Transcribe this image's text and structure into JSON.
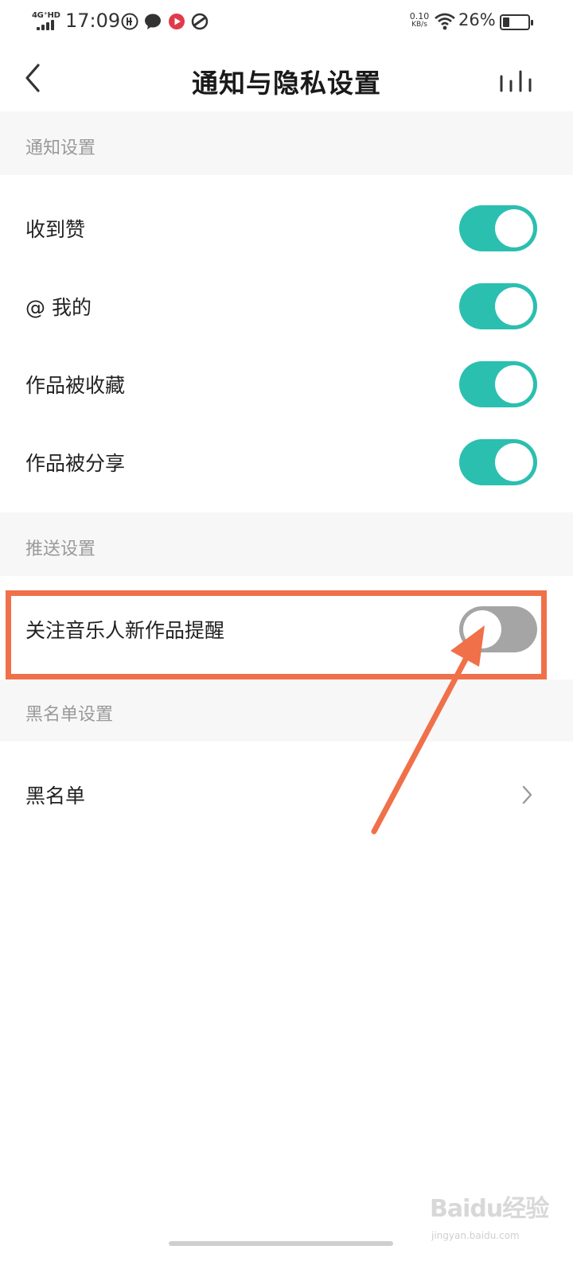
{
  "status_bar": {
    "network": "4G⁺HD",
    "time": "17:09",
    "net_speed_value": "0.10",
    "net_speed_unit": "KB/s",
    "battery_percent": "26%"
  },
  "header": {
    "title": "通知与隐私设置"
  },
  "sections": {
    "notify": {
      "title": "通知设置",
      "items": [
        {
          "label": "收到赞",
          "enabled": true
        },
        {
          "label": "@ 我的",
          "enabled": true
        },
        {
          "label": "作品被收藏",
          "enabled": true
        },
        {
          "label": "作品被分享",
          "enabled": true
        }
      ]
    },
    "push": {
      "title": "推送设置",
      "items": [
        {
          "label": "关注音乐人新作品提醒",
          "enabled": false
        }
      ]
    },
    "blacklist": {
      "title": "黑名单设置",
      "items": [
        {
          "label": "黑名单"
        }
      ]
    }
  },
  "colors": {
    "toggle_on": "#2bbfb0",
    "toggle_off": "#a5a5a5",
    "annotation": "#f0704a"
  },
  "watermark": {
    "logo": "Baidu经验",
    "url": "jingyan.baidu.com"
  }
}
